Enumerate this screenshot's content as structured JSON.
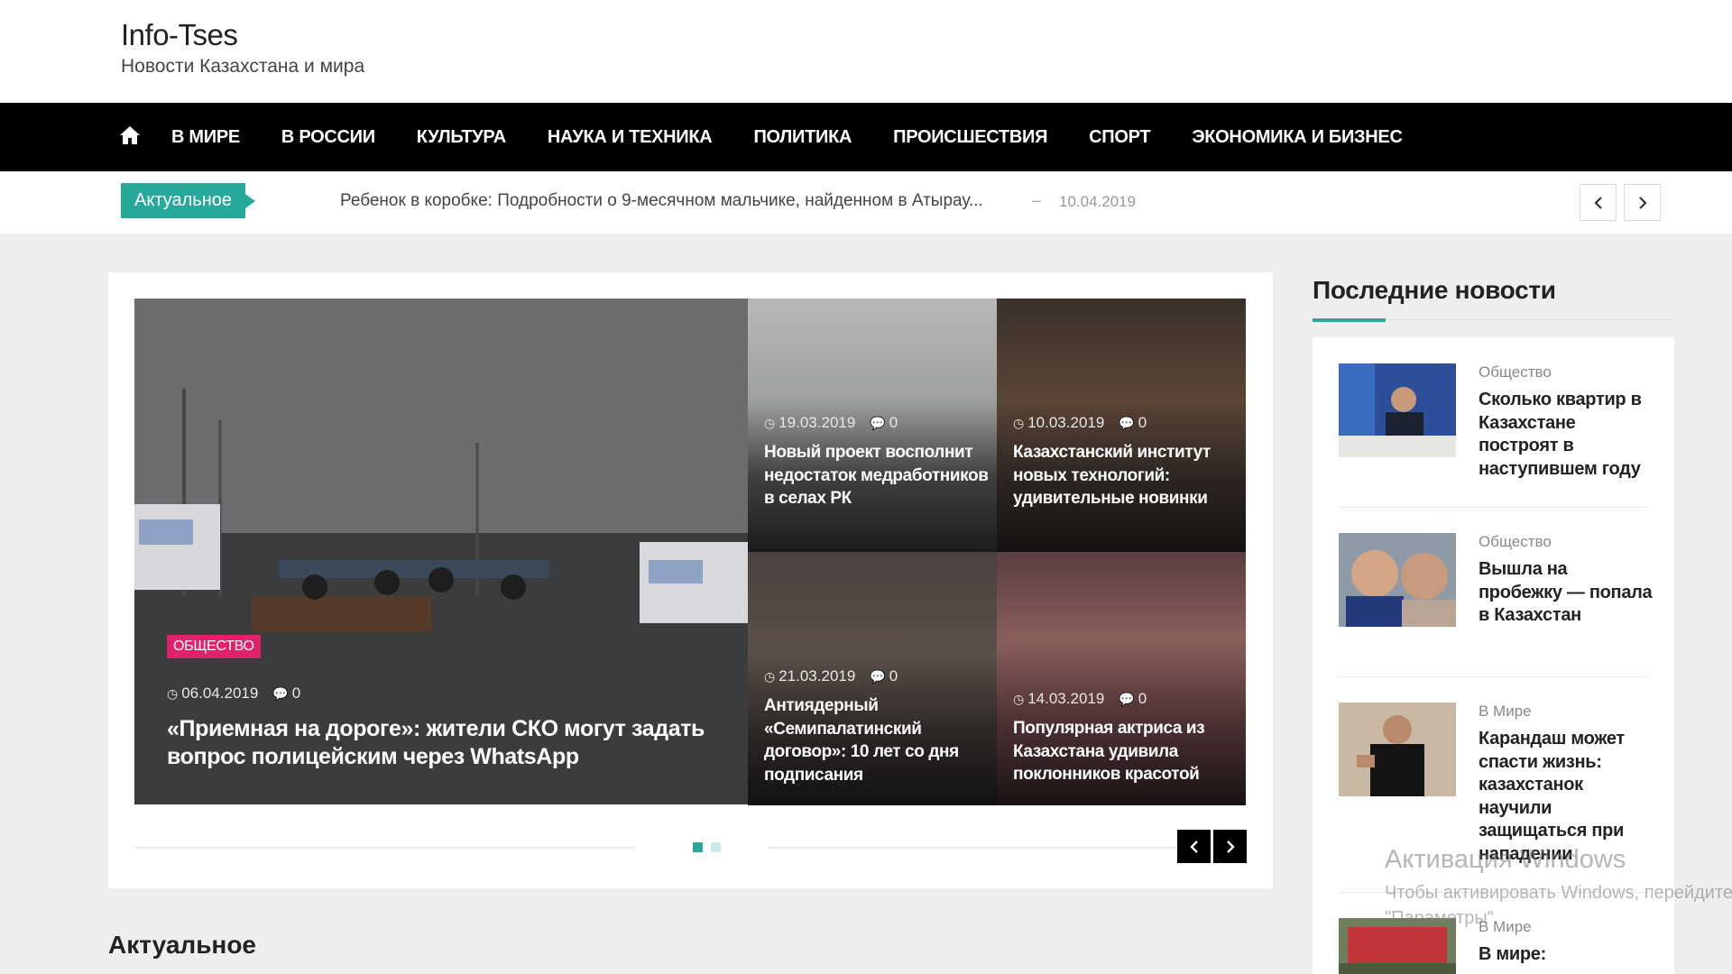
{
  "header": {
    "site_title": "Info-Tses",
    "tagline": "Новости Казахстана и мира"
  },
  "nav": {
    "home_icon": "home-icon",
    "items": [
      "В МИРЕ",
      "В РОССИИ",
      "КУЛЬТУРА",
      "НАУКА И ТЕХНИКА",
      "ПОЛИТИКА",
      "ПРОИСШЕСТВИЯ",
      "СПОРТ",
      "ЭКОНОМИКА И БИЗНЕС"
    ]
  },
  "ticker": {
    "label": "Актуальное",
    "headline": "Ребенок в коробке: Подробности о 9-месячном мальчике, найденном в Атырау...",
    "separator": "–",
    "date": "10.04.2019",
    "prev_icon": "chevron-left-icon",
    "next_icon": "chevron-right-icon"
  },
  "slider": {
    "featured": {
      "category": "ОБЩЕСТВО",
      "date": "06.04.2019",
      "comments": "0",
      "title": "«Приемная на дороге»: жители СКО могут задать вопрос полицейским через WhatsApp"
    },
    "posts": [
      {
        "date": "19.03.2019",
        "comments": "0",
        "title": "Новый проект восполнит недостаток медработников в селах РК"
      },
      {
        "date": "10.03.2019",
        "comments": "0",
        "title": "Казахстанский институт новых технологий: удивительные новинки"
      },
      {
        "date": "21.03.2019",
        "comments": "0",
        "title": "Антиядерный «Семипалатинский договор»: 10 лет со дня подписания"
      },
      {
        "date": "14.03.2019",
        "comments": "0",
        "title": "Популярная актриса из Казахстана удивила поклонников красотой"
      }
    ],
    "active_page": 1,
    "page_count": 2,
    "colors": {
      "dot_active": "#27a898",
      "dot_inactive": "#c9ecea"
    }
  },
  "sidebar": {
    "heading": "Последние новости",
    "items": [
      {
        "category": "Общество",
        "title": "Сколько квартир в Казахстане построят в наступившем году"
      },
      {
        "category": "Общество",
        "title": "Вышла на пробежку — попала в Казахстан"
      },
      {
        "category": "В Мире",
        "title": "Карандаш может спасти жизнь: казахстанок научили защищаться при нападении"
      },
      {
        "category": "В Мире",
        "title": "В мире:"
      }
    ]
  },
  "main": {
    "section_heading": "Актуальное"
  },
  "watermark": {
    "line1": "Активация Windows",
    "line2": "Чтобы активировать Windows, перейдите в раздел",
    "line3": "\"Параметры\"."
  },
  "colors": {
    "accent": "#27a898",
    "badge": "#e2216b",
    "nav_bg": "#000000"
  }
}
